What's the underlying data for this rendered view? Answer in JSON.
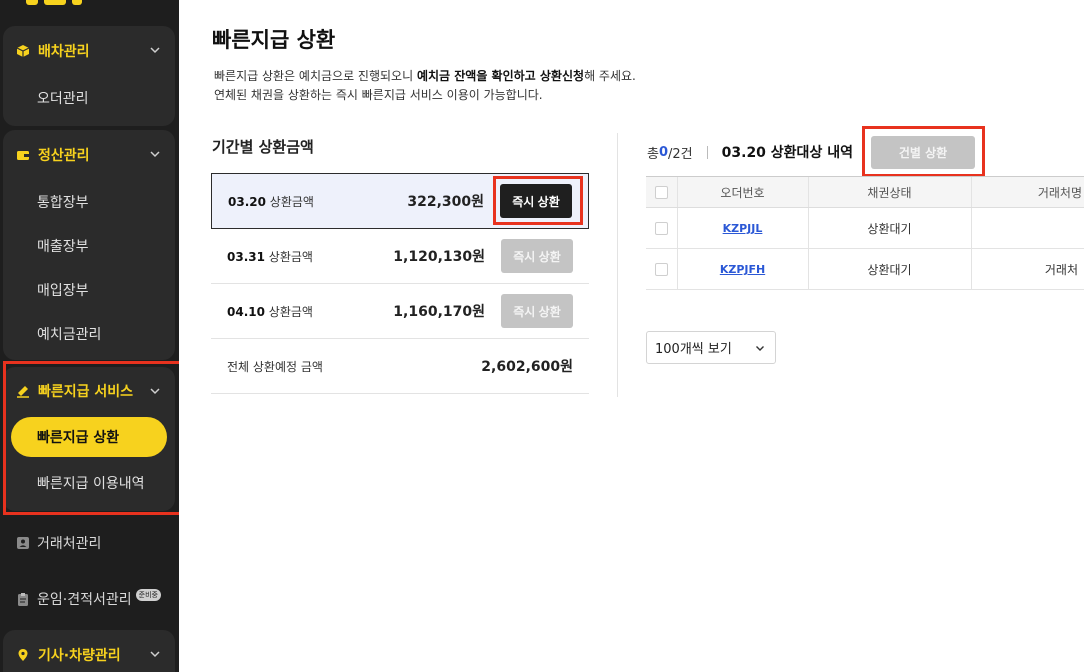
{
  "sidebar": {
    "groups": [
      {
        "label": "배차관리",
        "items": [
          "오더관리"
        ]
      },
      {
        "label": "정산관리",
        "items": [
          "통합장부",
          "매출장부",
          "매입장부",
          "예치금관리"
        ]
      },
      {
        "label": "빠른지급 서비스",
        "items": [
          "빠른지급 상환",
          "빠른지급 이용내역"
        ],
        "active_item": "빠른지급 상환"
      }
    ],
    "plain_items": [
      "거래처관리",
      "운임·견적서관리"
    ],
    "new_badge": "준비중",
    "bottom_group": "기사·차량관리"
  },
  "page": {
    "title": "빠른지급 상환",
    "desc_line1_pre": "빠른지급 상환은 예치금으로 진행되오니 ",
    "desc_line1_bold": "예치금 잔액을 확인하고 상환신청",
    "desc_line1_post": "해 주세요.",
    "desc_line2": "연체된 채권을 상환하는 즉시 빠른지급 서비스 이용이 가능합니다."
  },
  "period": {
    "section_title": "기간별 상환금액",
    "rows": [
      {
        "date": "03.20",
        "label": " 상환금액",
        "amount": "322,300원",
        "button": "즉시 상환",
        "state": "active"
      },
      {
        "date": "03.31",
        "label": " 상환금액",
        "amount": "1,120,130원",
        "button": "즉시 상환",
        "state": "disabled"
      },
      {
        "date": "04.10",
        "label": " 상환금액",
        "amount": "1,160,170원",
        "button": "즉시 상환",
        "state": "disabled"
      }
    ],
    "total_label": "전체 상환예정 금액",
    "total_amount": "2,602,600원"
  },
  "target": {
    "count_prefix": "총 ",
    "count_selected": "0",
    "count_rest": "/2건",
    "title": "03.20 상환대상 내역",
    "each_button": "건별 상환",
    "columns": [
      "오더번호",
      "채권상태",
      "거래처명"
    ],
    "rows": [
      {
        "order_no": "KZPJJL",
        "status": "상환대기",
        "client": ""
      },
      {
        "order_no": "KZPJFH",
        "status": "상환대기",
        "client": "거래처"
      }
    ],
    "page_size": "100개씩 보기"
  },
  "colors": {
    "accent": "#f7d21e",
    "sidebar_bg": "#1e1e1e",
    "highlight_border": "#e8321e",
    "link": "#2b58d6"
  }
}
